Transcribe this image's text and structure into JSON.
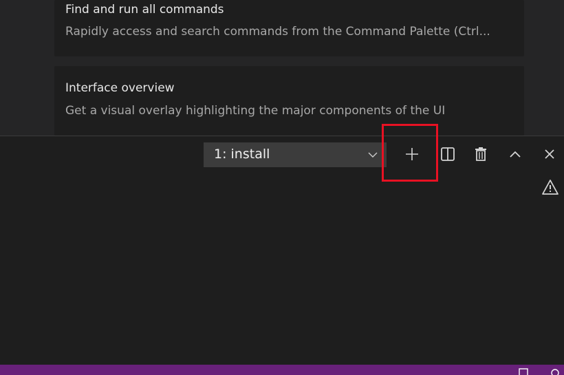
{
  "walkthrough": {
    "items": [
      {
        "title": "Find and run all commands",
        "description": "Rapidly access and search commands from the Command Palette (Ctrl..."
      },
      {
        "title": "Interface overview",
        "description": "Get a visual overlay highlighting the major components of the UI"
      }
    ]
  },
  "panel": {
    "terminal_select": {
      "selected": "1: install"
    },
    "actions": [
      "plus-icon",
      "split-icon",
      "trash-icon",
      "chevron-up-icon",
      "close-icon"
    ],
    "warning_icon": "warning-icon"
  },
  "statusbar": {
    "color": "#68217a"
  },
  "colors": {
    "highlight": "#e81123",
    "editor_bg": "#1e1e1e",
    "select_bg": "#3c3c3c"
  }
}
